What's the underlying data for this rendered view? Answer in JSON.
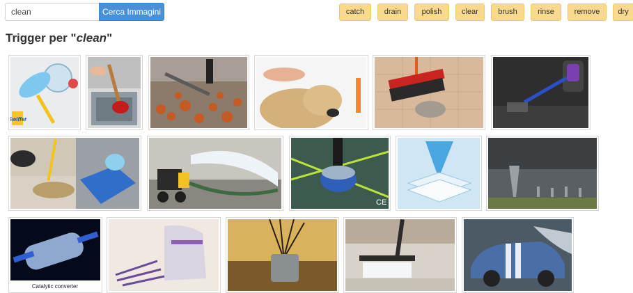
{
  "search": {
    "value": "clean",
    "button_label": "Cerca Immagini"
  },
  "suggestions": [
    "catch",
    "drain",
    "polish",
    "clear",
    "brush",
    "rinse",
    "remove",
    "dry"
  ],
  "heading": {
    "prefix": "Trigger per \"",
    "term": "clean",
    "suffix": "\""
  },
  "images": [
    {
      "subject": "duster-cleaning-product",
      "logo_text": "Swiffer"
    },
    {
      "subject": "plunger-in-sink"
    },
    {
      "subject": "leaf-blower-autumn-leaves"
    },
    {
      "subject": "dog-being-washed"
    },
    {
      "subject": "broom-sweeping-dust"
    },
    {
      "subject": "cordless-vacuum-cleaner"
    },
    {
      "subject": "mop-and-cloth-cleaning-floor"
    },
    {
      "subject": "water-pump-spraying"
    },
    {
      "subject": "floor-scrubber-machine",
      "mark_text": "CE"
    },
    {
      "subject": "tornado-over-pads"
    },
    {
      "subject": "tornado-storm-clouds"
    },
    {
      "subject": "catalytic-converter",
      "caption": "Catalytic converter"
    },
    {
      "subject": "lavender-sachet"
    },
    {
      "subject": "reed-diffuser"
    },
    {
      "subject": "vacuum-steam-on-floor"
    },
    {
      "subject": "car-wash-spray"
    }
  ]
}
